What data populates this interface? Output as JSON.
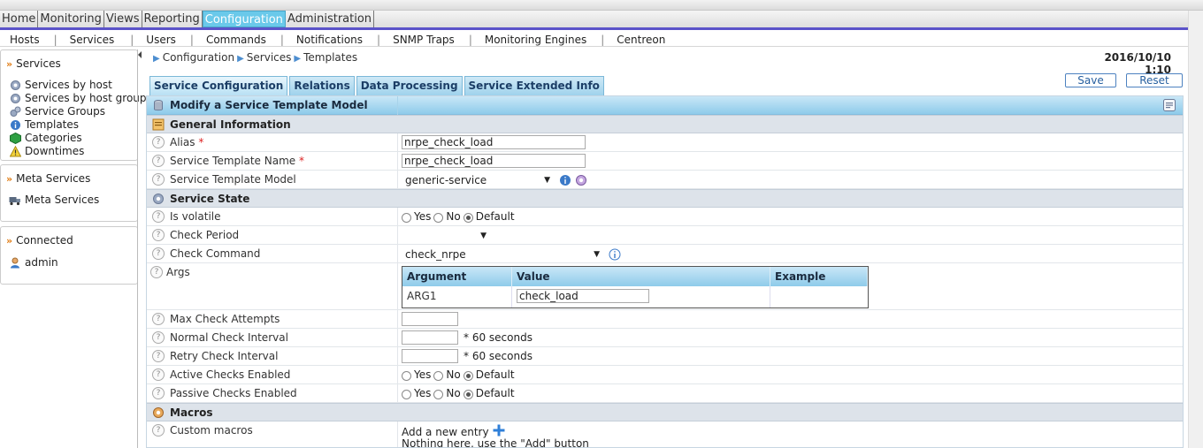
{
  "main_menu": [
    "Home",
    "Monitoring",
    "Views",
    "Reporting",
    "Configuration",
    "Administration"
  ],
  "sub_menu": [
    "Hosts",
    "Services",
    "Users",
    "Commands",
    "Notifications",
    "SNMP Traps",
    "Monitoring Engines",
    "Centreon"
  ],
  "sidebar": {
    "services_title": "Services",
    "services_items": [
      "Services by host",
      "Services by host group",
      "Service Groups",
      "Templates",
      "Categories",
      "Downtimes"
    ],
    "meta_title": "Meta Services",
    "meta_items": [
      "Meta Services"
    ],
    "connected_title": "Connected",
    "connected_user": "admin"
  },
  "breadcrumb": [
    "Configuration",
    "Services",
    "Templates"
  ],
  "timestamp": "2016/10/10 1:10",
  "tabs": [
    "Service Configuration",
    "Relations",
    "Data Processing",
    "Service Extended Info"
  ],
  "buttons": {
    "save": "Save",
    "reset": "Reset"
  },
  "form": {
    "title": "Modify a Service Template Model",
    "sections": {
      "general": "General Information",
      "state": "Service State",
      "macros": "Macros"
    },
    "required_mark": "*",
    "fields": {
      "alias": {
        "label": "Alias",
        "value": "nrpe_check_load"
      },
      "template_name": {
        "label": "Service Template Name",
        "value": "nrpe_check_load"
      },
      "template_model": {
        "label": "Service Template Model",
        "value": "generic-service"
      },
      "is_volatile": {
        "label": "Is volatile"
      },
      "check_period": {
        "label": "Check Period",
        "value": ""
      },
      "check_command": {
        "label": "Check Command",
        "value": "check_nrpe"
      },
      "args": {
        "label": "Args",
        "headers": [
          "Argument",
          "Value",
          "Example"
        ],
        "rows": [
          {
            "argument": "ARG1",
            "value": "check_load",
            "example": ""
          }
        ]
      },
      "max_check_attempts": {
        "label": "Max Check Attempts",
        "value": ""
      },
      "normal_interval": {
        "label": "Normal Check Interval",
        "value": "",
        "suffix": "* 60 seconds"
      },
      "retry_interval": {
        "label": "Retry Check Interval",
        "value": "",
        "suffix": "* 60 seconds"
      },
      "active_checks": {
        "label": "Active Checks Enabled"
      },
      "passive_checks": {
        "label": "Passive Checks Enabled"
      },
      "custom_macros": {
        "label": "Custom macros",
        "add_text": "Add a new entry",
        "empty_text": "Nothing here, use the \"Add\" button"
      }
    },
    "radio_options": {
      "yes": "Yes",
      "no": "No",
      "default": "Default"
    }
  },
  "help_glyph": "?",
  "icons": {
    "chevron": "»",
    "bc_arrow": "▶",
    "caret": "▼"
  },
  "colors": {
    "accent": "#6ac9ea",
    "menu_border": "#5b53c9",
    "header_blue": "#8ecbea"
  }
}
